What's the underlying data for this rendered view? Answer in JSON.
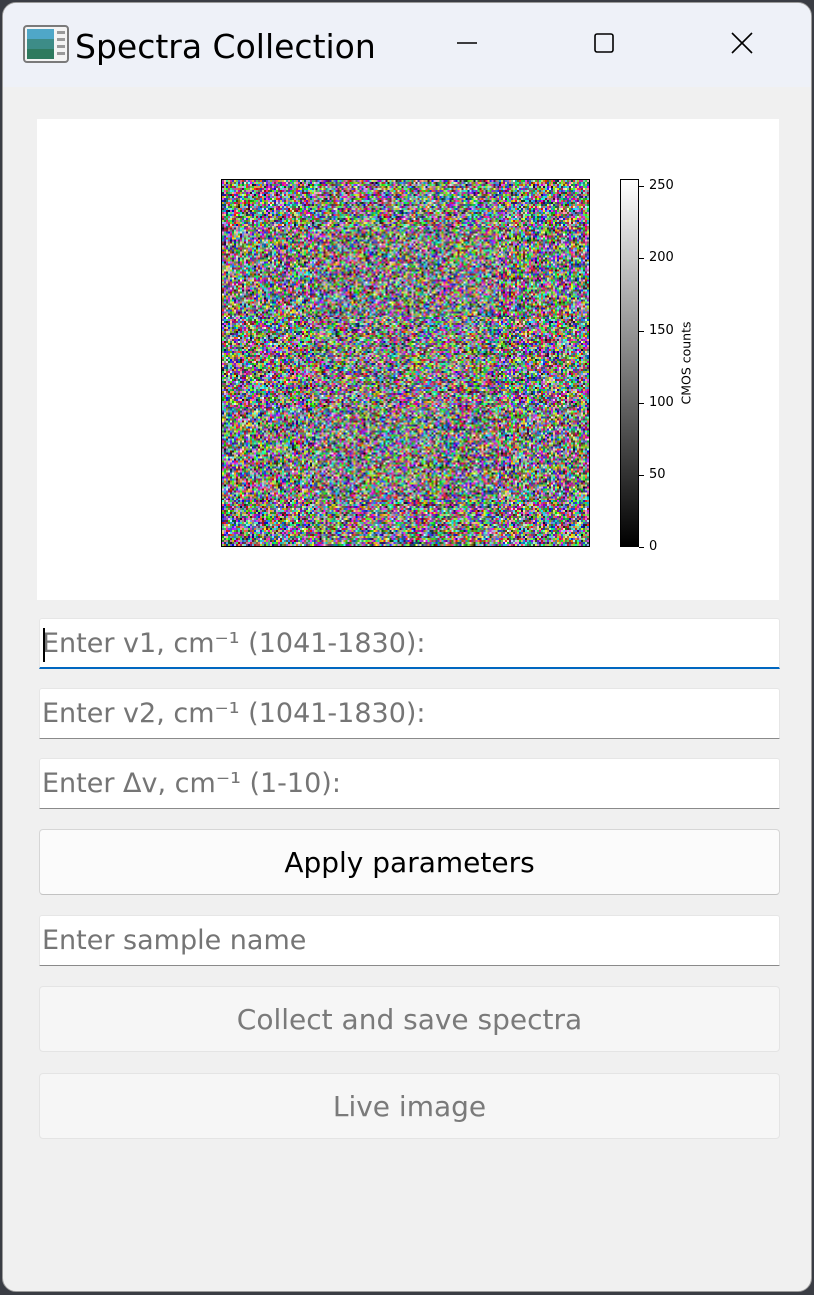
{
  "window": {
    "title": "Spectra Collection",
    "icon": "spectra-app-icon",
    "controls": {
      "minimize_icon": "minimize-icon",
      "maximize_icon": "maximize-icon",
      "close_icon": "close-icon"
    }
  },
  "image_plot": {
    "image": "random-rgb-noise",
    "colorbar": {
      "label": "CMOS counts",
      "colormap": "gray",
      "range": [
        0,
        255
      ],
      "ticks": [
        "0",
        "50",
        "100",
        "150",
        "200",
        "250"
      ]
    }
  },
  "inputs": {
    "v1": {
      "placeholder": "Enter v1, cm⁻¹ (1041-1830):",
      "value": "",
      "focused": true
    },
    "v2": {
      "placeholder": "Enter v2, cm⁻¹ (1041-1830):",
      "value": ""
    },
    "dv": {
      "placeholder": "Enter Δv, cm⁻¹ (1-10):",
      "value": ""
    },
    "sample": {
      "placeholder": "Enter sample name",
      "value": ""
    }
  },
  "buttons": {
    "apply": {
      "label": "Apply parameters",
      "enabled": true
    },
    "collect": {
      "label": "Collect and save spectra",
      "enabled": false
    },
    "live": {
      "label": "Live image",
      "enabled": false
    }
  },
  "colors": {
    "accent": "#0067c0",
    "window_bg": "#f0f0f0",
    "titlebar_bg": "#eef1f8",
    "disabled_text": "#7a7a7a",
    "placeholder_text": "#757575"
  }
}
